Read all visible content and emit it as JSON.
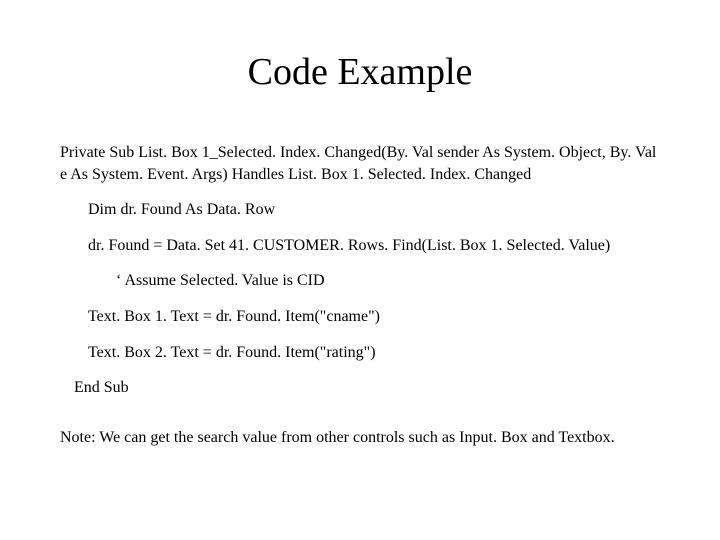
{
  "title": "Code Example",
  "code": {
    "signature": "Private Sub List. Box 1_Selected. Index. Changed(By. Val sender As System. Object, By. Val e As System. Event. Args) Handles List. Box 1. Selected. Index. Changed",
    "dim": "Dim dr. Found As Data. Row",
    "assign": "dr. Found = Data. Set 41. CUSTOMER. Rows. Find(List. Box 1. Selected. Value)",
    "comment": "‘ Assume Selected. Value is CID",
    "text1": "Text. Box 1. Text = dr. Found. Item(\"cname\")",
    "text2": "Text. Box 2. Text = dr. Found. Item(\"rating\")",
    "endsub": "End Sub"
  },
  "note": "Note: We can get the search value from other controls such as Input. Box and Textbox."
}
